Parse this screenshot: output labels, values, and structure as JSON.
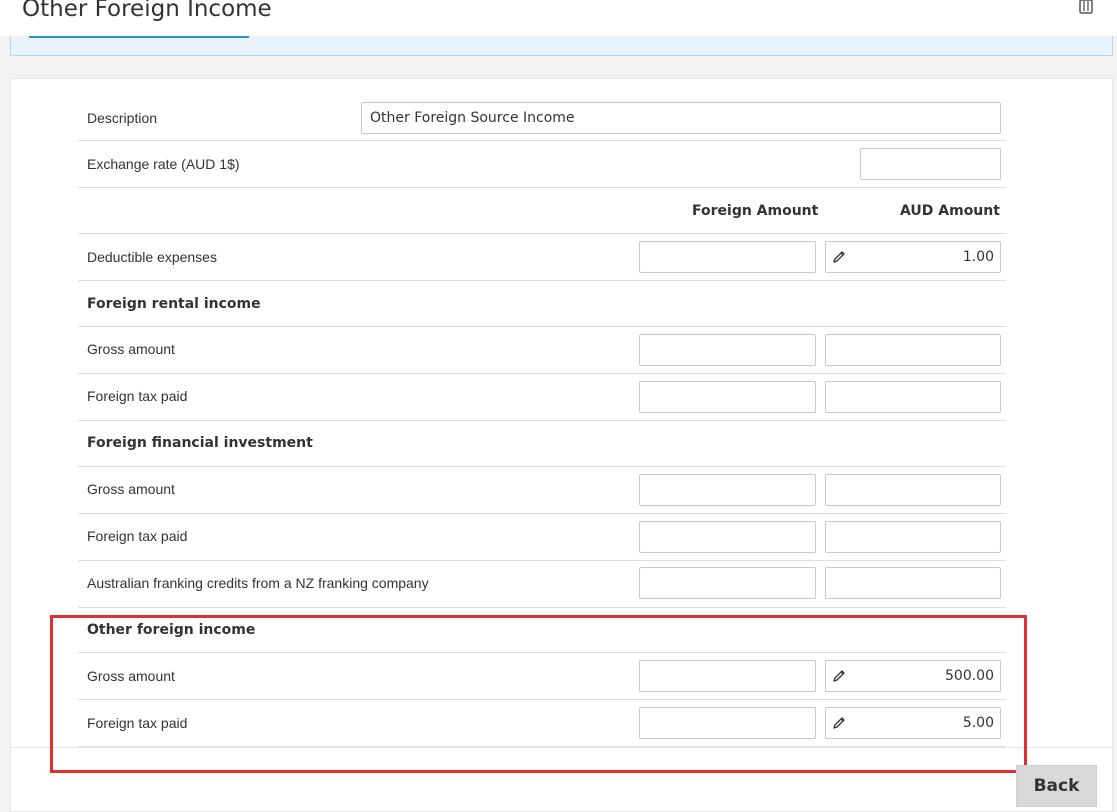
{
  "page": {
    "title": "Other Foreign Income"
  },
  "form": {
    "description": {
      "label": "Description",
      "value": "Other Foreign Source Income"
    },
    "exchange_rate": {
      "label": "Exchange rate (AUD 1$)",
      "value": ""
    },
    "columns": {
      "foreign": "Foreign Amount",
      "aud": "AUD Amount"
    },
    "deductible_expenses": {
      "label": "Deductible expenses",
      "foreign": "",
      "aud": "1.00"
    },
    "foreign_rental_income": {
      "heading": "Foreign rental income",
      "gross_amount": {
        "label": "Gross amount",
        "foreign": "",
        "aud": ""
      },
      "foreign_tax_paid": {
        "label": "Foreign tax paid",
        "foreign": "",
        "aud": ""
      }
    },
    "foreign_financial_investment": {
      "heading": "Foreign financial investment",
      "gross_amount": {
        "label": "Gross amount",
        "foreign": "",
        "aud": ""
      },
      "foreign_tax_paid": {
        "label": "Foreign tax paid",
        "foreign": "",
        "aud": ""
      },
      "franking_credits": {
        "label": "Australian franking credits from a NZ franking company",
        "foreign": "",
        "aud": ""
      }
    },
    "other_foreign_income": {
      "heading": "Other foreign income",
      "gross_amount": {
        "label": "Gross amount",
        "foreign": "",
        "aud": "500.00"
      },
      "foreign_tax_paid": {
        "label": "Foreign tax paid",
        "foreign": "",
        "aud": "5.00"
      }
    }
  },
  "footer": {
    "back_label": "Back"
  },
  "colors": {
    "highlight": "#e03035",
    "accent": "#2f8fd6"
  },
  "icons": [
    "trash-icon",
    "pencil-icon"
  ]
}
